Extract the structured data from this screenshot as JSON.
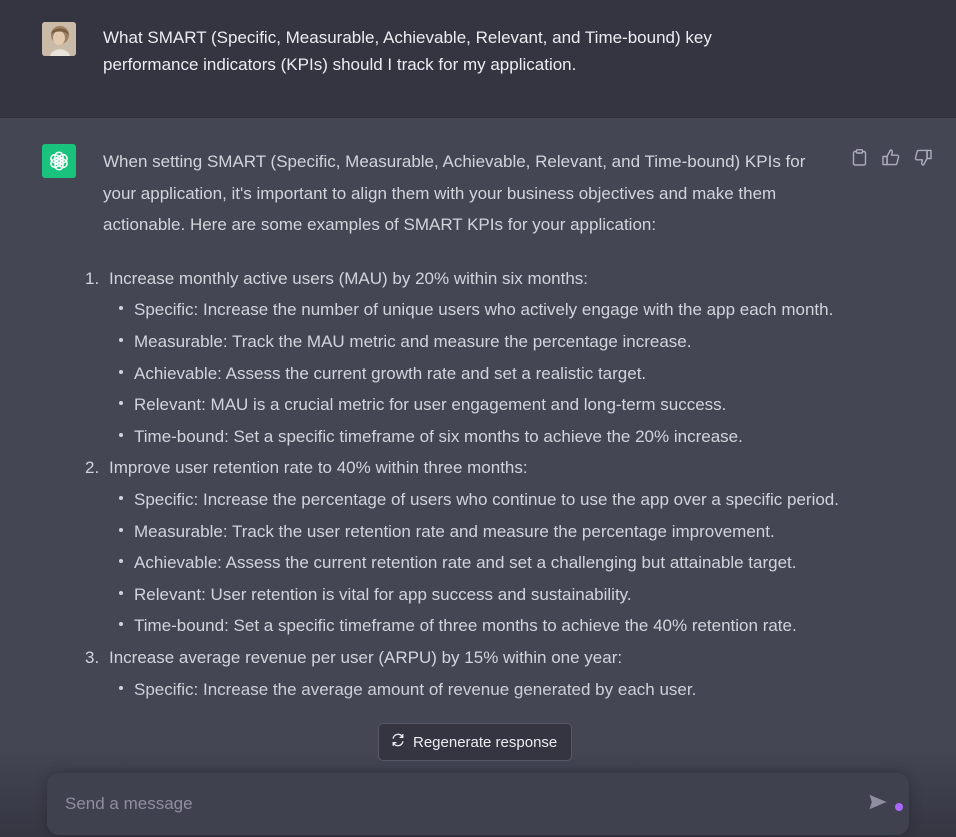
{
  "conversation": {
    "user_message": "What SMART (Specific, Measurable, Achievable, Relevant, and Time-bound) key performance indicators (KPIs) should I track for my application.",
    "assistant": {
      "intro": "When setting SMART (Specific, Measurable, Achievable, Relevant, and Time-bound) KPIs for your application, it's important to align them with your business objectives and make them actionable. Here are some examples of SMART KPIs for your application:",
      "items": [
        {
          "number": "1.",
          "title": "Increase monthly active users (MAU) by 20% within six months:",
          "bullets": [
            "Specific: Increase the number of unique users who actively engage with the app each month.",
            "Measurable: Track the MAU metric and measure the percentage increase.",
            "Achievable: Assess the current growth rate and set a realistic target.",
            "Relevant: MAU is a crucial metric for user engagement and long-term success.",
            "Time-bound: Set a specific timeframe of six months to achieve the 20% increase."
          ]
        },
        {
          "number": "2.",
          "title": "Improve user retention rate to 40% within three months:",
          "bullets": [
            "Specific: Increase the percentage of users who continue to use the app over a specific period.",
            "Measurable: Track the user retention rate and measure the percentage improvement.",
            "Achievable: Assess the current retention rate and set a challenging but attainable target.",
            "Relevant: User retention is vital for app success and sustainability.",
            "Time-bound: Set a specific timeframe of three months to achieve the 40% retention rate."
          ]
        },
        {
          "number": "3.",
          "title": "Increase average revenue per user (ARPU) by 15% within one year:",
          "bullets": [
            "Specific: Increase the average amount of revenue generated by each user."
          ]
        }
      ]
    }
  },
  "actions": {
    "copy_icon": "clipboard-icon",
    "like_icon": "thumbs-up-icon",
    "dislike_icon": "thumbs-down-icon"
  },
  "regenerate": {
    "label": "Regenerate response",
    "icon": "refresh-icon"
  },
  "composer": {
    "placeholder": "Send a message",
    "value": "",
    "send_icon": "send-icon"
  },
  "colors": {
    "user_bg": "#343541",
    "assistant_bg": "#444654",
    "gpt_avatar": "#19c37d",
    "input_bg": "#40414f",
    "indicator_dot": "#ab68ff"
  }
}
